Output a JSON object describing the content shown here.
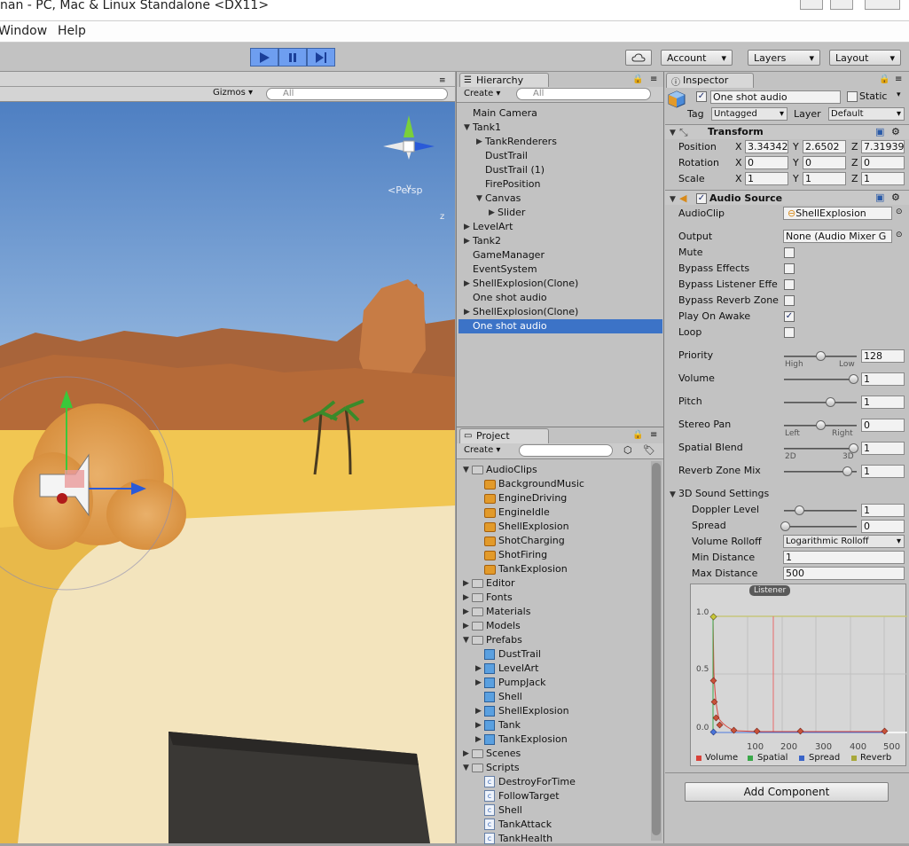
{
  "window": {
    "title": "nan - PC, Mac & Linux Standalone <DX11>"
  },
  "menu": [
    "Window",
    "Help"
  ],
  "toolbar": {
    "account": "Account",
    "layers": "Layers",
    "layout": "Layout"
  },
  "scene": {
    "gizmos": "Gizmos",
    "search_placeholder": "All",
    "persp": "Persp",
    "axis_y": "y",
    "axis_z": "z"
  },
  "hierarchy": {
    "tab": "Hierarchy",
    "create": "Create",
    "search_placeholder": "All",
    "items": [
      "Main Camera",
      "Tank1",
      "TankRenderers",
      "DustTrail",
      "DustTrail (1)",
      "FirePosition",
      "Canvas",
      "Slider",
      "LevelArt",
      "Tank2",
      "GameManager",
      "EventSystem",
      "ShellExplosion(Clone)",
      "One shot audio",
      "ShellExplosion(Clone)",
      "One shot audio"
    ]
  },
  "project": {
    "tab": "Project",
    "create": "Create",
    "items": [
      "AudioClips",
      "BackgroundMusic",
      "EngineDriving",
      "EngineIdle",
      "ShellExplosion",
      "ShotCharging",
      "ShotFiring",
      "TankExplosion",
      "Editor",
      "Fonts",
      "Materials",
      "Models",
      "Prefabs",
      "DustTrail",
      "LevelArt",
      "PumpJack",
      "Shell",
      "ShellExplosion",
      "Tank",
      "TankExplosion",
      "Scenes",
      "Scripts",
      "DestroyForTime",
      "FollowTarget",
      "Shell",
      "TankAttack",
      "TankHealth"
    ]
  },
  "inspector": {
    "tab": "Inspector",
    "object_name": "One shot audio",
    "static_label": "Static",
    "tag_label": "Tag",
    "tag_value": "Untagged",
    "layer_label": "Layer",
    "layer_value": "Default",
    "transform": {
      "title": "Transform",
      "position_label": "Position",
      "rotation_label": "Rotation",
      "scale_label": "Scale",
      "position": [
        "3.34342",
        "2.6502",
        "7.31939"
      ],
      "rotation": [
        "0",
        "0",
        "0"
      ],
      "scale": [
        "1",
        "1",
        "1"
      ],
      "x": "X",
      "y": "Y",
      "z": "Z"
    },
    "audio_source": {
      "title": "Audio Source",
      "audioclip_label": "AudioClip",
      "audioclip_value": "ShellExplosion",
      "output_label": "Output",
      "output_value": "None (Audio Mixer G",
      "mute": "Mute",
      "bypass_effects": "Bypass Effects",
      "bypass_listener": "Bypass Listener Effe",
      "bypass_reverb": "Bypass Reverb Zone",
      "play_on_awake": "Play On Awake",
      "loop": "Loop",
      "priority_label": "Priority",
      "priority": "128",
      "high": "High",
      "low": "Low",
      "volume_label": "Volume",
      "volume": "1",
      "pitch_label": "Pitch",
      "pitch": "1",
      "stereo_label": "Stereo Pan",
      "stereo": "0",
      "left": "Left",
      "right": "Right",
      "spatial_label": "Spatial Blend",
      "spatial": "1",
      "s2d": "2D",
      "s3d": "3D",
      "reverb_label": "Reverb Zone Mix",
      "reverb": "1"
    },
    "sound3d": {
      "title": "3D Sound Settings",
      "doppler_label": "Doppler Level",
      "doppler": "1",
      "spread_label": "Spread",
      "spread": "0",
      "rolloff_label": "Volume Rolloff",
      "rolloff": "Logarithmic Rolloff",
      "min_label": "Min Distance",
      "min": "1",
      "max_label": "Max Distance",
      "max": "500"
    },
    "graph": {
      "listener": "Listener",
      "y_ticks": [
        "1.0",
        "0.5",
        "0.0"
      ],
      "x_ticks": [
        "100",
        "200",
        "300",
        "400",
        "500"
      ],
      "legend": [
        "Volume",
        "Spatial",
        "Spread",
        "Reverb"
      ],
      "colors": {
        "volume": "#d9423a",
        "spatial": "#3aa84a",
        "spread": "#3a64c8",
        "reverb": "#a8a83a"
      }
    },
    "add_component": "Add Component"
  }
}
